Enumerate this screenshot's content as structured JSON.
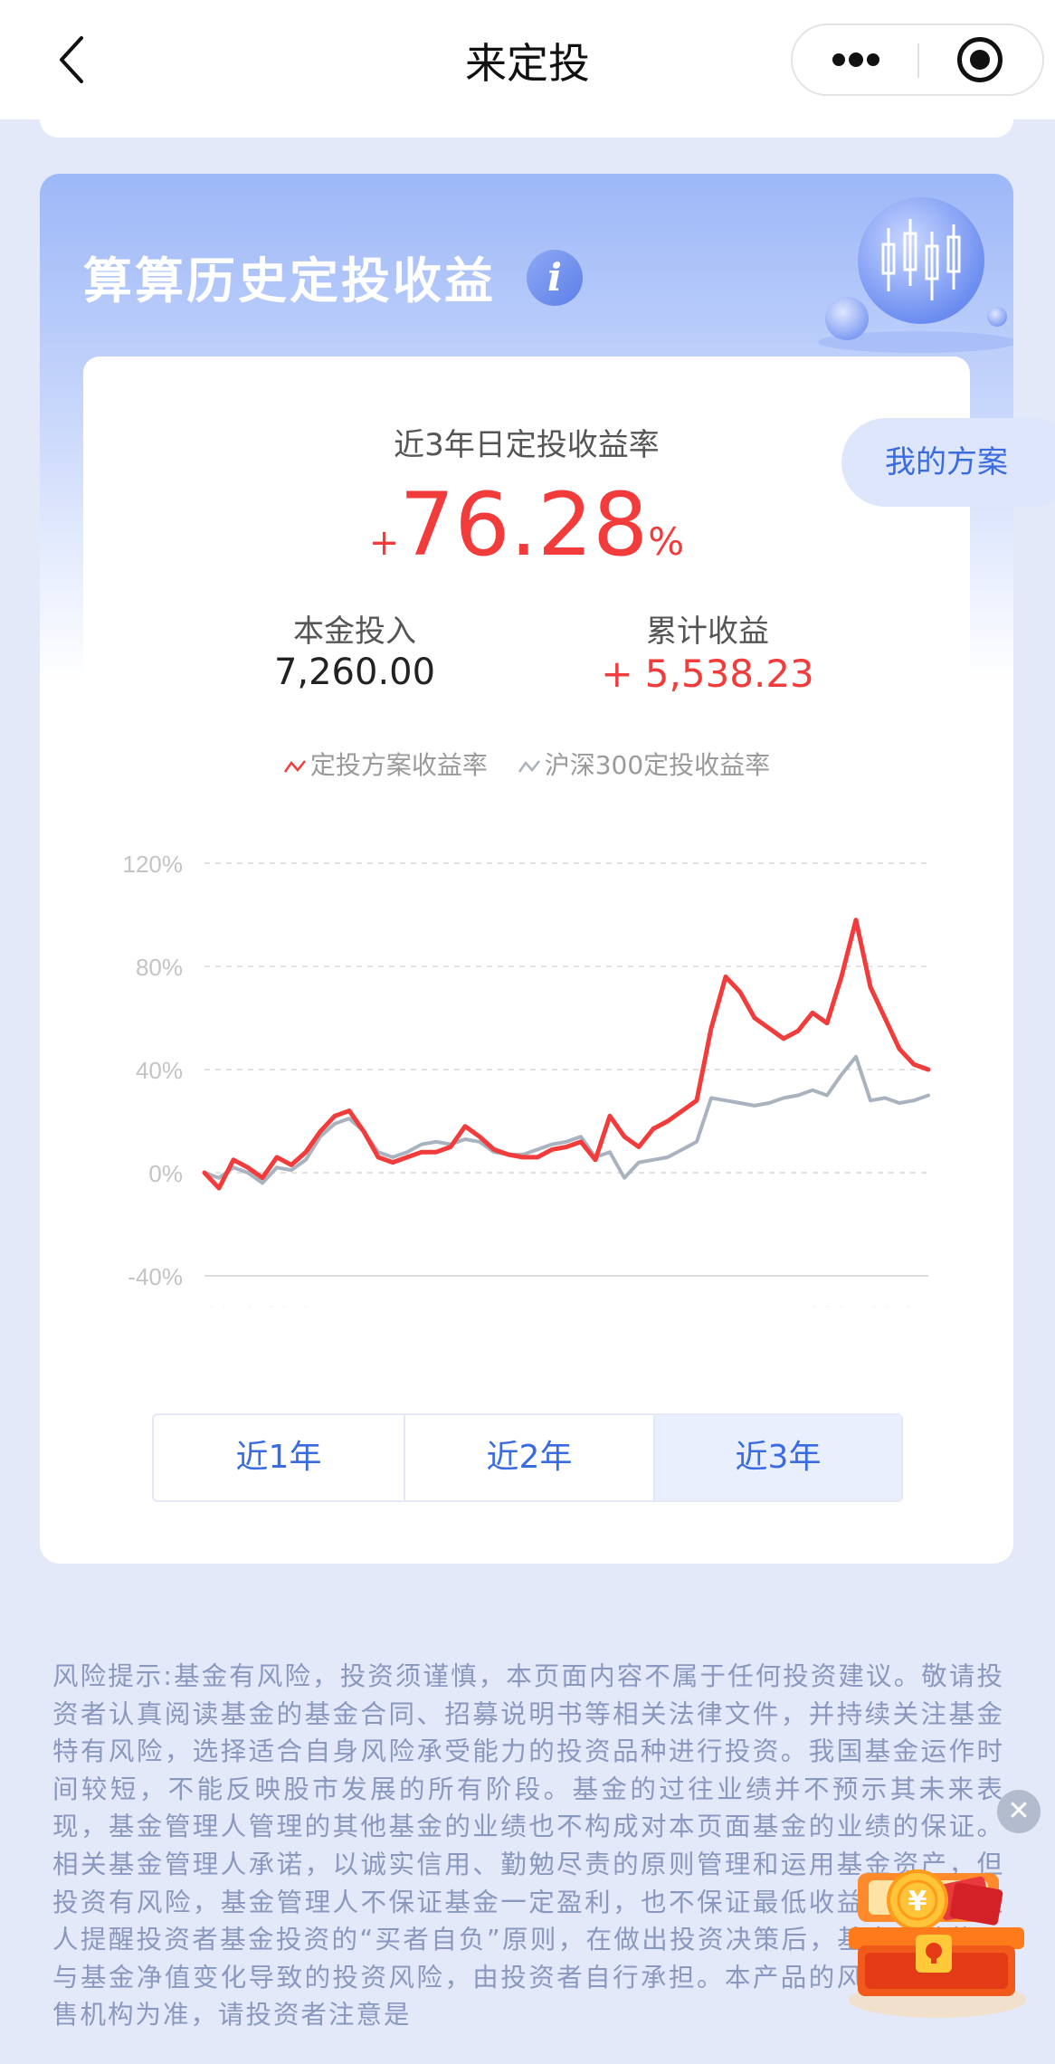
{
  "nav": {
    "title": "来定投"
  },
  "card": {
    "title": "算算历史定投收益",
    "info_icon_glyph": "i",
    "rate_label": "近3年日定投收益率",
    "rate_sign": "+",
    "rate_value": "76.28",
    "rate_unit": "%",
    "principal_label": "本金投入",
    "principal_value": "7,260.00",
    "profit_label": "累计收益",
    "profit_value": "+ 5,538.23",
    "legend": [
      {
        "label": "定投方案收益率",
        "color": "#f23b3b"
      },
      {
        "label": "沪深300定投收益率",
        "color": "#a9b2bf"
      }
    ],
    "tabs": [
      {
        "label": "近1年",
        "active": false
      },
      {
        "label": "近2年",
        "active": false
      },
      {
        "label": "近3年",
        "active": true
      }
    ]
  },
  "my_plan_label": "我的方案",
  "risk_text": "风险提示:基金有风险，投资须谨慎，本页面内容不属于任何投资建议。敬请投资者认真阅读基金的基金合同、招募说明书等相关法律文件，并持续关注基金特有风险，选择适合自身风险承受能力的投资品种进行投资。我国基金运作时间较短，不能反映股市发展的所有阶段。基金的过往业绩并不预示其未来表现，基金管理人管理的其他基金的业绩也不构成对本页面基金的业绩的保证。相关基金管理人承诺，以诚实信用、勤勉尽责的原则管理和运用基金资产，但投资有风险，基金管理人不保证基金一定盈利，也不保证最低收益。基金管理人提醒投资者基金投资的“买者自负”原则，在做出投资决策后，基金运营状况与基金净值变化导致的投资风险，由投资者自行承担。本产品的风险等级以销售机构为准，请投资者注意是",
  "colors": {
    "accent": "#3a6be0",
    "up": "#f23b3b",
    "benchmark": "#a9b2bf"
  },
  "chart_data": {
    "type": "line",
    "x_start": "2018-09-28",
    "x_end": "2021-09-24",
    "x_tick_labels": [
      "2018-09-28",
      "2021-09-24"
    ],
    "y_ticks": [
      "120%",
      "80%",
      "40%",
      "0%",
      "-40%"
    ],
    "ylim": [
      -40,
      120
    ],
    "grid": true,
    "legend_position": "top",
    "x": [
      0,
      2,
      4,
      6,
      8,
      10,
      12,
      14,
      16,
      18,
      20,
      22,
      24,
      26,
      28,
      30,
      32,
      34,
      36,
      38,
      40,
      42,
      44,
      46,
      48,
      50,
      52,
      54,
      56,
      58,
      60,
      62,
      64,
      66,
      68,
      70,
      72,
      74,
      76,
      78,
      80,
      82,
      84,
      86,
      88,
      90,
      92,
      94,
      96,
      98,
      100
    ],
    "series": [
      {
        "name": "定投方案收益率",
        "values": [
          0,
          -6,
          5,
          2,
          -2,
          6,
          3,
          8,
          16,
          22,
          24,
          16,
          6,
          4,
          6,
          8,
          8,
          10,
          18,
          14,
          9,
          7,
          6,
          6,
          9,
          10,
          12,
          5,
          22,
          14,
          10,
          17,
          20,
          24,
          28,
          56,
          76,
          70,
          60,
          56,
          52,
          55,
          62,
          58,
          76,
          98,
          72,
          60,
          48,
          42,
          40
        ]
      },
      {
        "name": "沪深300定投收益率",
        "values": [
          0,
          -2,
          2,
          0,
          -4,
          2,
          1,
          5,
          14,
          19,
          21,
          16,
          8,
          6,
          8,
          11,
          12,
          11,
          13,
          12,
          8,
          7,
          7,
          9,
          11,
          12,
          14,
          6,
          8,
          -2,
          4,
          5,
          6,
          9,
          12,
          29,
          28,
          27,
          26,
          27,
          29,
          30,
          32,
          30,
          38,
          45,
          28,
          29,
          27,
          28,
          30
        ]
      }
    ]
  }
}
